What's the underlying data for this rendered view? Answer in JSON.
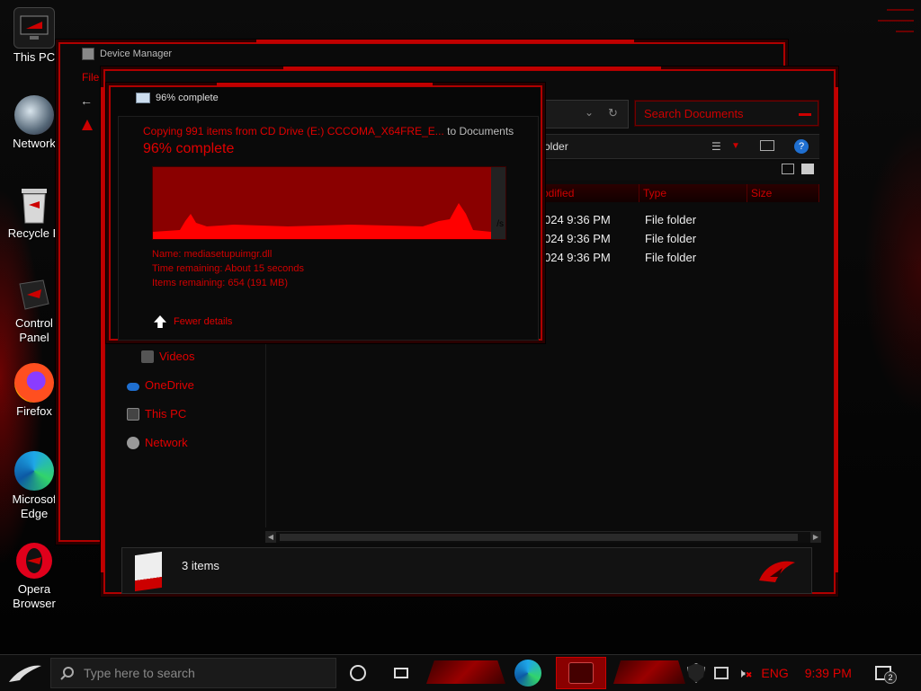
{
  "desktop": {
    "icons": [
      {
        "label": "This PC",
        "icon": "this-pc-icon"
      },
      {
        "label": "Network",
        "icon": "network-icon"
      },
      {
        "label": "Recycle B",
        "icon": "recycle-bin-icon"
      },
      {
        "label": "Control Panel",
        "icon": "control-panel-icon"
      },
      {
        "label": "Firefox",
        "icon": "firefox-icon"
      },
      {
        "label": "Microsof Edge",
        "icon": "edge-icon"
      },
      {
        "label": "Opera Browser",
        "icon": "opera-icon"
      }
    ]
  },
  "device_manager": {
    "title": "Device Manager",
    "menu_label": "File"
  },
  "explorer": {
    "search_placeholder": "Search Documents",
    "toolbar_label": "older",
    "columns": [
      {
        "label": "odified"
      },
      {
        "label": "Type"
      },
      {
        "label": "Size"
      }
    ],
    "rows": [
      {
        "modified": "024 9:36 PM",
        "type": "File folder"
      },
      {
        "modified": "024 9:36 PM",
        "type": "File folder"
      },
      {
        "modified": "024 9:36 PM",
        "type": "File folder"
      }
    ],
    "nav": [
      {
        "label": "Videos",
        "icon": "videos-icon"
      },
      {
        "label": "OneDrive",
        "icon": "onedrive-icon"
      },
      {
        "label": "This PC",
        "icon": "this-pc-icon"
      },
      {
        "label": "Network",
        "icon": "network-icon"
      }
    ],
    "status": "3 items"
  },
  "copy_dialog": {
    "title": "96% complete",
    "copying_prefix": "Copying 991 items from CD Drive (E:) CCCOMA_X64FRE_E...",
    "copying_to": "to",
    "copying_dest": "Documents",
    "percent_text": "96% complete",
    "name_line": "Name:  mediasetupuimgr.dll",
    "time_line": "Time remaining:  About 15 seconds",
    "items_line": "Items remaining:  654 (191 MB)",
    "speed_text": "/s",
    "fewer_details": "Fewer details",
    "progress_percent": 96
  },
  "taskbar": {
    "search_placeholder": "Type here to search",
    "language": "ENG",
    "time": "9:39 PM",
    "notification_count": "2"
  },
  "colors": {
    "accent": "#e00000",
    "frame": "#b00000",
    "background": "#050505"
  }
}
